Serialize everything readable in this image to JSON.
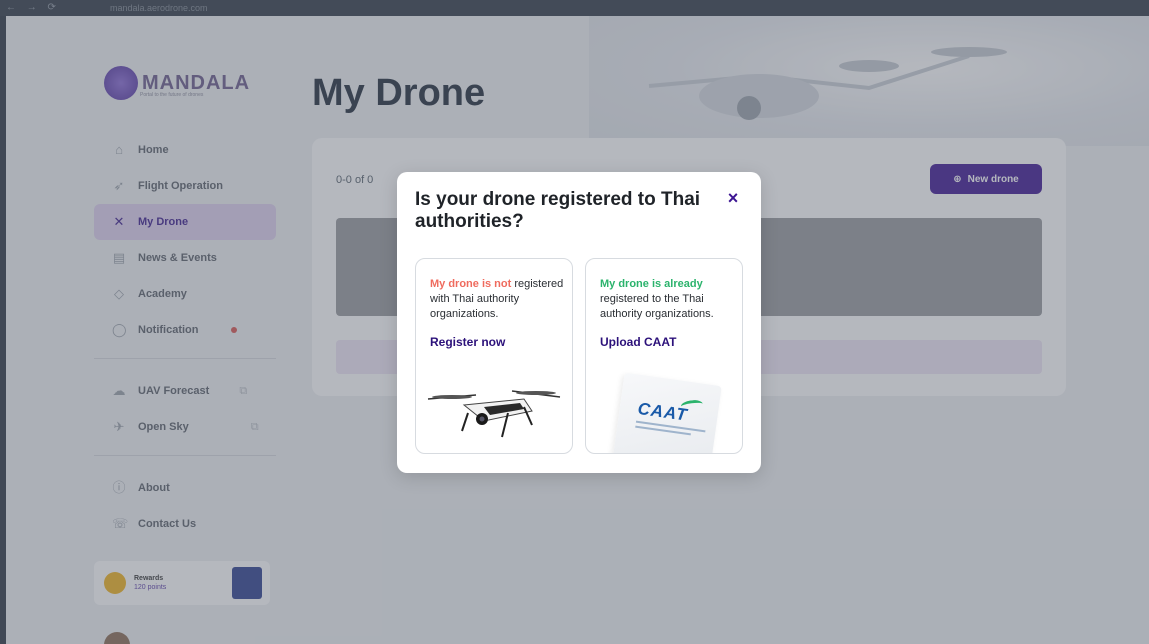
{
  "browser": {
    "nav_glyphs": "← → ⟳",
    "url": "mandala.aerodrone.com"
  },
  "sidebar": {
    "logo_text": "MANDALA",
    "logo_subtitle": "Portal to the future of drones",
    "items": [
      {
        "label": "Home",
        "icon": "home-icon",
        "glyph": "⌂"
      },
      {
        "label": "Flight Operation",
        "icon": "send-icon",
        "glyph": "➶"
      },
      {
        "label": "My Drone",
        "icon": "drone-icon",
        "glyph": "✕"
      },
      {
        "label": "News & Events",
        "icon": "news-icon",
        "glyph": "▤"
      },
      {
        "label": "Academy",
        "icon": "academy-icon",
        "glyph": "◇"
      },
      {
        "label": "Notification",
        "icon": "bell-icon",
        "glyph": "◯"
      },
      {
        "label": "UAV Forecast",
        "icon": "cloud-icon",
        "glyph": "☁"
      },
      {
        "label": "Open Sky",
        "icon": "plane-icon",
        "glyph": "✈"
      },
      {
        "label": "About",
        "icon": "info-icon",
        "glyph": "ⓘ"
      },
      {
        "label": "Contact Us",
        "icon": "contact-icon",
        "glyph": "☏"
      }
    ],
    "ext_glyph": "⧉",
    "rewards": {
      "title": "Rewards",
      "points": "120 points"
    }
  },
  "main": {
    "title": "My Drone",
    "count": "0-0 of 0",
    "new_drone_label": "New drone",
    "new_drone_glyph": "⊕"
  },
  "modal": {
    "title": "Is your drone registered to Thai authorities?",
    "close_glyph": "×",
    "options": [
      {
        "highlight": "My drone is not",
        "rest": "registered with Thai authority organizations.",
        "action": "Register now"
      },
      {
        "highlight": "My drone is already",
        "rest": "registered to the Thai authority organizations.",
        "action": "Upload CAAT"
      }
    ],
    "caat_logo": "CAAT"
  }
}
